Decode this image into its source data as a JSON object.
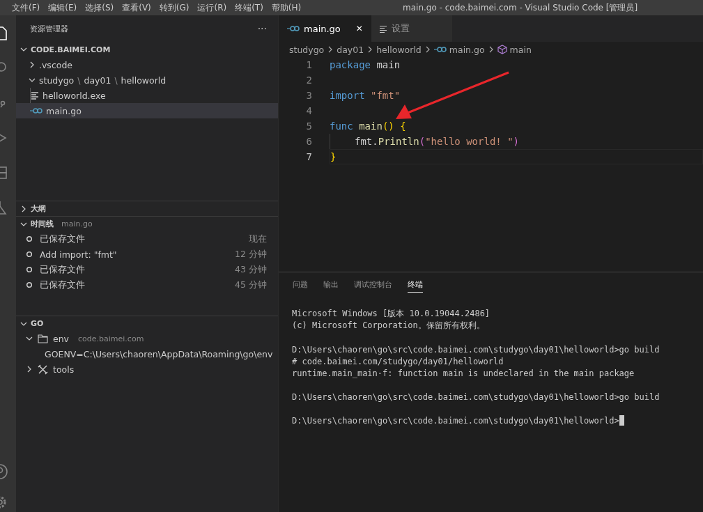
{
  "window": {
    "title": "main.go - code.baimei.com - Visual Studio Code [管理员]"
  },
  "menu": [
    "文件(F)",
    "编辑(E)",
    "选择(S)",
    "查看(V)",
    "转到(G)",
    "运行(R)",
    "终端(T)",
    "帮助(H)"
  ],
  "explorer": {
    "title": "资源管理器",
    "more": "···",
    "root": {
      "label": "CODE.BAIMEI.COM",
      "expanded": true,
      "children": [
        {
          "segments": [
            ".vscode"
          ],
          "expanded": false
        },
        {
          "segments": [
            "studygo",
            "day01",
            "helloworld"
          ],
          "separator": "\\",
          "expanded": true,
          "children": [
            {
              "kind": "text-file",
              "label": "helloworld.exe",
              "selected": false
            },
            {
              "kind": "go-file",
              "label": "main.go",
              "selected": true
            }
          ]
        }
      ]
    }
  },
  "outline": {
    "title": "大纲",
    "expanded": false
  },
  "timeline": {
    "title": "时间线",
    "file": "main.go",
    "expanded": true,
    "items": [
      {
        "label": "已保存文件",
        "time": "现在"
      },
      {
        "label": "Add import:  \"fmt\"",
        "time": "12 分钟"
      },
      {
        "label": "已保存文件",
        "time": "43 分钟"
      },
      {
        "label": "已保存文件",
        "time": "45 分钟"
      }
    ]
  },
  "go": {
    "title": "GO",
    "expanded": true,
    "items": [
      {
        "kind": "folder",
        "label": "env",
        "description": "code.baimei.com",
        "expanded": true,
        "children": [
          "GOENV=C:\\Users\\chaoren\\AppData\\Roaming\\go\\env"
        ]
      },
      {
        "kind": "tools",
        "label": "tools",
        "expanded": false
      }
    ]
  },
  "editor_tabs": [
    {
      "kind": "go",
      "label": "main.go",
      "selected": true,
      "close": "✕"
    },
    {
      "kind": "settings",
      "label": "设置",
      "selected": false
    }
  ],
  "breadcrumbs": [
    {
      "kind": "folder",
      "label": "studygo"
    },
    {
      "kind": "folder",
      "label": "day01"
    },
    {
      "kind": "folder",
      "label": "helloworld"
    },
    {
      "kind": "go",
      "label": "main.go"
    },
    {
      "kind": "symbol",
      "label": "main"
    }
  ],
  "code": [
    {
      "number": "1",
      "active": false,
      "indent": false,
      "tokens": [
        {
          "kind": "keyword",
          "text": "package"
        },
        {
          "kind": "plain",
          "text": " main"
        }
      ]
    },
    {
      "number": "2",
      "active": false,
      "indent": false
    },
    {
      "number": "3",
      "active": false,
      "indent": false,
      "tokens": [
        {
          "kind": "keyword",
          "text": "import "
        },
        {
          "kind": "string",
          "text": "\"fmt\""
        }
      ]
    },
    {
      "number": "4",
      "active": false,
      "indent": false
    },
    {
      "number": "5",
      "active": false,
      "indent": false,
      "tokens": [
        {
          "kind": "keyword",
          "text": "func "
        },
        {
          "kind": "function",
          "text": "main"
        },
        {
          "kind": "bracket",
          "text": "() {"
        }
      ]
    },
    {
      "number": "6",
      "active": false,
      "indent": true,
      "tokens": [
        {
          "kind": "plain",
          "text": "fmt."
        },
        {
          "kind": "function",
          "text": "Println"
        },
        {
          "kind": "bracket2",
          "text": "("
        },
        {
          "kind": "string",
          "text": "\"hello world! \""
        },
        {
          "kind": "bracket2",
          "text": ")"
        }
      ]
    },
    {
      "number": "7",
      "active": true,
      "indent": false,
      "tokens": [
        {
          "kind": "bracket",
          "text": "}"
        }
      ]
    }
  ],
  "panel": {
    "tabs": [
      {
        "label": "问题",
        "selected": false
      },
      {
        "label": "输出",
        "selected": false
      },
      {
        "label": "调试控制台",
        "selected": false
      },
      {
        "label": "终端",
        "selected": true
      }
    ],
    "terminal": {
      "cursor": true,
      "blocks": [
        [
          "Microsoft Windows [版本 10.0.19044.2486]",
          "(c) Microsoft Corporation。保留所有权利。"
        ],
        [
          "D:\\Users\\chaoren\\go\\src\\code.baimei.com\\studygo\\day01\\helloworld>go build",
          "# code.baimei.com/studygo/day01/helloworld",
          "runtime.main_main·f: function main is undeclared in the main package"
        ],
        [
          "D:\\Users\\chaoren\\go\\src\\code.baimei.com\\studygo\\day01\\helloworld>go build"
        ],
        [
          "D:\\Users\\chaoren\\go\\src\\code.baimei.com\\studygo\\day01\\helloworld>"
        ]
      ]
    }
  }
}
